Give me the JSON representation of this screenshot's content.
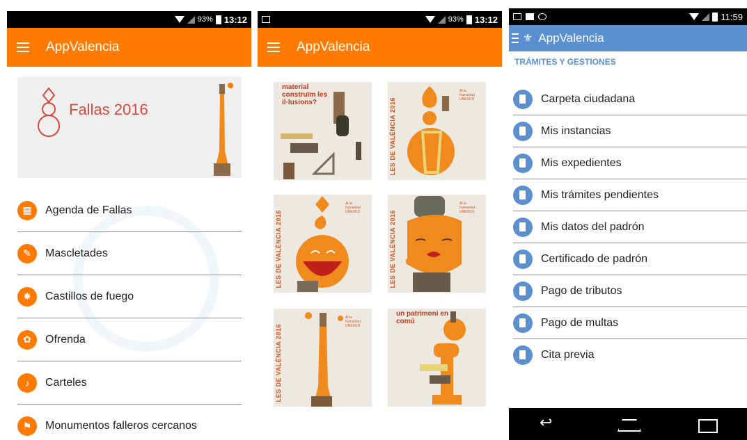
{
  "phone1": {
    "status": {
      "battery": "93%",
      "time": "13:12"
    },
    "app_title": "AppValencia",
    "banner_title": "Fallas 2016",
    "menu": [
      {
        "label": "Agenda de Fallas",
        "icon": "calendar-icon"
      },
      {
        "label": "Mascletades",
        "icon": "firecracker-icon"
      },
      {
        "label": "Castillos de fuego",
        "icon": "fireworks-icon"
      },
      {
        "label": "Ofrenda",
        "icon": "flower-icon"
      },
      {
        "label": "Carteles",
        "icon": "poster-icon"
      },
      {
        "label": "Monumentos falleros cercanos",
        "icon": "monument-icon"
      }
    ]
  },
  "phone2": {
    "status": {
      "battery": "93%",
      "time": "13:12"
    },
    "app_title": "AppValencia",
    "posters": [
      {
        "vertical_text": "",
        "top_text": "material construïm les il·lusions?",
        "small_text": ""
      },
      {
        "vertical_text": "LES DE VALÈNCIA 2016",
        "top_text": "",
        "small_text": "Al la humanitat UNESCO"
      },
      {
        "vertical_text": "LES DE VALÈNCIA 2016",
        "top_text": "",
        "small_text": "Al la humanitat UNESCO"
      },
      {
        "vertical_text": "LES DE VALÈNCIA 2016",
        "top_text": "",
        "small_text": "Al la humanitat UNESCO"
      },
      {
        "vertical_text": "LES DE VALÈNCIA 2016",
        "top_text": "",
        "small_text": "Al la humanitat UNESCO"
      },
      {
        "vertical_text": "",
        "top_text": "un patrimoni en comú",
        "small_text": ""
      }
    ]
  },
  "phone3": {
    "status": {
      "time": "11:59"
    },
    "app_title": "AppValencia",
    "section_title": "TRÁMITES Y GESTIONES",
    "menu": [
      {
        "label": "Carpeta ciudadana"
      },
      {
        "label": "Mis instancias"
      },
      {
        "label": "Mis expedientes"
      },
      {
        "label": "Mis trámites pendientes"
      },
      {
        "label": "Mis datos del padrón"
      },
      {
        "label": "Certificado de padrón"
      },
      {
        "label": "Pago de tributos"
      },
      {
        "label": "Pago de multas"
      },
      {
        "label": "Cita previa"
      }
    ]
  },
  "colors": {
    "orange": "#ff7a00",
    "blue": "#5a8fd0",
    "divider": "#6c8fc8"
  }
}
